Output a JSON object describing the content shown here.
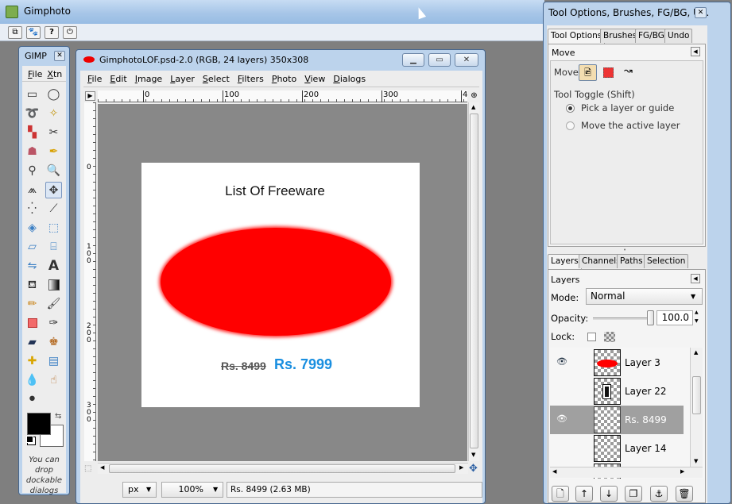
{
  "app_window": {
    "title": "Gimphoto"
  },
  "top_icons": [
    "window-icon",
    "paw-icon",
    "help-icon",
    "power-icon"
  ],
  "toolbox": {
    "title": "GIMP",
    "menu": [
      "File",
      "Xtn"
    ],
    "hint": "You can drop dockable dialogs"
  },
  "image_window": {
    "title": "GimphotoLOF.psd-2.0 (RGB, 24 layers) 350x308",
    "menu": [
      "File",
      "Edit",
      "Image",
      "Layer",
      "Select",
      "Filters",
      "Photo",
      "View",
      "Dialogs"
    ],
    "ruler_top": [
      "0",
      "100",
      "200",
      "300",
      "4"
    ],
    "ruler_left": [
      "0",
      "1\n0\n0",
      "2\n0\n0",
      "3\n0\n0"
    ],
    "canvas": {
      "heading": "List Of Freeware",
      "old_price": "Rs. 8499",
      "new_price": "Rs. 7999",
      "ellipse_color": "#ff0000",
      "price_color": "#1a8fe0"
    },
    "status": {
      "unit": "px",
      "zoom": "100%",
      "layer_info": "Rs. 8499 (2.63 MB)"
    }
  },
  "dock": {
    "title": "Tool Options, Brushes, FG/BG, U...",
    "tabs_top": [
      "Tool Options",
      "Brushes",
      "FG/BG",
      "Undo"
    ],
    "tool_options": {
      "header": "Move",
      "move_label": "Move:",
      "toggle_label": "Tool Toggle  (Shift)",
      "options": [
        "Pick a layer or guide",
        "Move the active layer"
      ],
      "selected_option": 0
    },
    "tabs_bottom": [
      "Layers",
      "Channels",
      "Paths",
      "Selection"
    ],
    "layers": {
      "header": "Layers",
      "mode_label": "Mode:",
      "mode_value": "Normal",
      "opacity_label": "Opacity:",
      "opacity_value": "100.0",
      "opacity": 1.0,
      "lock_label": "Lock:",
      "items": [
        {
          "name": "Layer 3",
          "visible": true,
          "selected": false
        },
        {
          "name": "Layer 22",
          "visible": false,
          "selected": false
        },
        {
          "name": "Rs. 8499",
          "visible": true,
          "selected": true
        },
        {
          "name": "Layer 14",
          "visible": false,
          "selected": false
        }
      ]
    }
  }
}
